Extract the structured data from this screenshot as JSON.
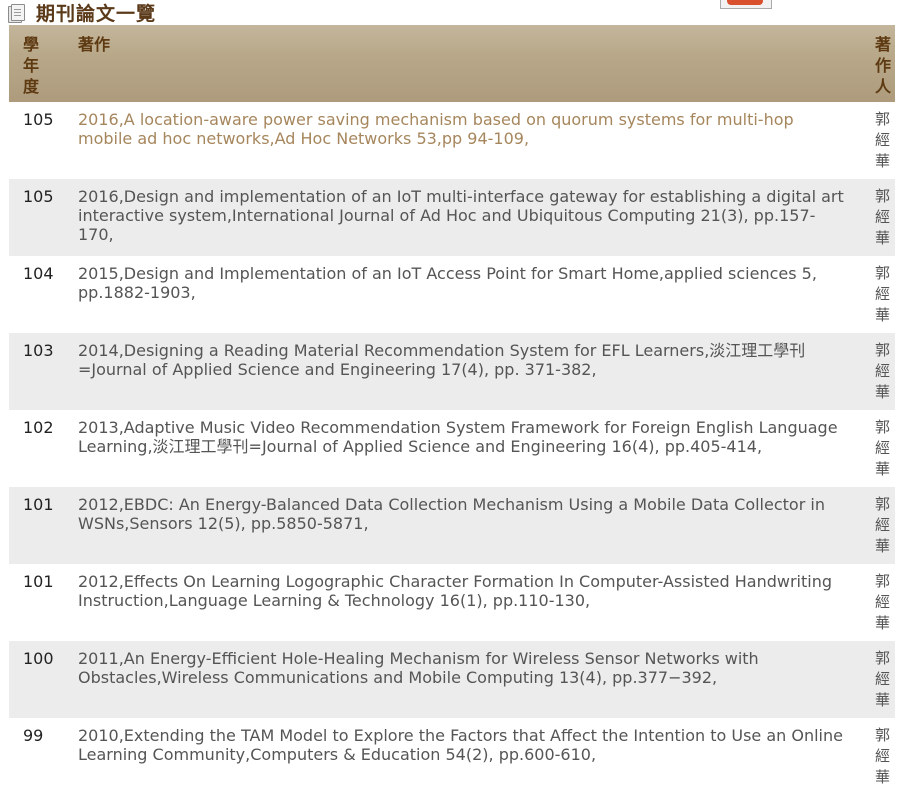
{
  "page": {
    "title": "期刊論文一覽"
  },
  "table": {
    "headers": {
      "year": "學\n年\n度",
      "work": "著作",
      "author": "著\n作\n人"
    },
    "rows": [
      {
        "year": "105",
        "work": "2016,A location-aware power saving mechanism based on quorum systems for multi-hop mobile ad hoc networks,Ad Hoc Networks 53,pp 94-109,",
        "author": "郭\n經\n華",
        "highlight": true
      },
      {
        "year": "105",
        "work": "2016,Design and implementation of an IoT multi-interface gateway for establishing a digital art interactive system,International Journal of Ad Hoc and Ubiquitous Computing 21(3), pp.157-170,",
        "author": "郭\n經\n華"
      },
      {
        "year": "104",
        "work": "2015,Design and Implementation of an IoT Access Point for Smart Home,applied sciences 5, pp.1882-1903,",
        "author": "郭\n經\n華"
      },
      {
        "year": "103",
        "work": "2014,Designing a Reading Material Recommendation System for EFL Learners,淡江理工學刊=Journal of Applied Science and Engineering 17(4), pp. 371-382,",
        "author": "郭\n經\n華"
      },
      {
        "year": "102",
        "work": "2013,Adaptive Music Video Recommendation System Framework for Foreign English Language Learning,淡江理工學刊=Journal of Applied Science and Engineering 16(4), pp.405-414,",
        "author": "郭\n經\n華"
      },
      {
        "year": "101",
        "work": "2012,EBDC: An Energy-Balanced Data Collection Mechanism Using a Mobile Data Collector in WSNs,Sensors 12(5), pp.5850-5871,",
        "author": "郭\n經\n華"
      },
      {
        "year": "101",
        "work": "2012,Effects On Learning Logographic Character Formation In Computer-Assisted Handwriting Instruction,Language Learning & Technology 16(1), pp.110-130,",
        "author": "郭\n經\n華"
      },
      {
        "year": "100",
        "work": "2011,An Energy-Efficient Hole-Healing Mechanism for Wireless Sensor Networks with Obstacles,Wireless Communications and Mobile Computing 13(4), pp.377−392,",
        "author": "郭\n經\n華"
      },
      {
        "year": "99",
        "work": "2010,Extending the TAM Model to Explore the Factors that Affect the Intention to Use an Online Learning Community,Computers & Education 54(2), pp.600-610,",
        "author": "郭\n經\n華"
      }
    ]
  },
  "icons": {
    "title": "document-icon"
  },
  "colors": {
    "header_bg": "#b3a284",
    "header_text": "#5e3a12",
    "link": "#a6865c",
    "alt_row": "#ececec"
  }
}
